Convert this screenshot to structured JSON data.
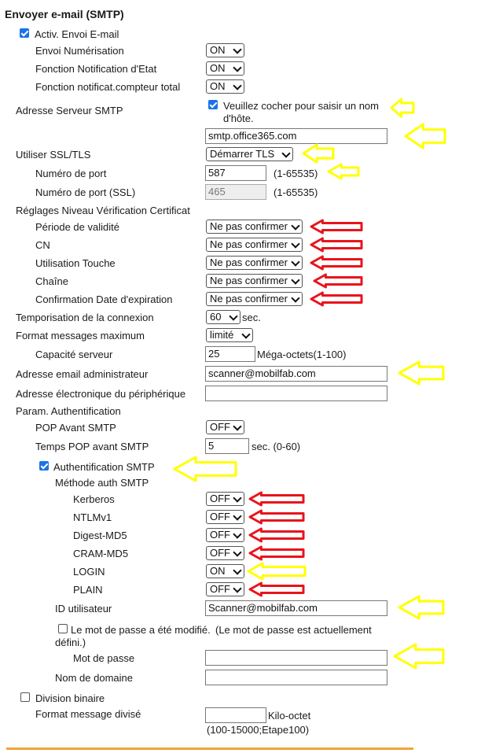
{
  "title": "Envoyer e-mail (SMTP)",
  "activ": {
    "label": "Activ. Envoi E-mail",
    "checked": true
  },
  "rows": {
    "envoi_num": {
      "label": "Envoi Numérisation",
      "value": "ON"
    },
    "notif_etat": {
      "label": "Fonction Notification d'Etat",
      "value": "ON"
    },
    "notif_compteur": {
      "label": "Fonction notificat.compteur total",
      "value": "ON"
    }
  },
  "smtp_server": {
    "label": "Adresse Serveur SMTP",
    "checkbox_label": "Veuillez cocher pour saisir un nom d'hôte.",
    "value": "smtp.office365.com"
  },
  "ssl": {
    "label": "Utiliser SSL/TLS",
    "value": "Démarrer TLS"
  },
  "port": {
    "label": "Numéro de port",
    "value": "587",
    "range": "(1-65535)"
  },
  "port_ssl": {
    "label": "Numéro de port (SSL)",
    "value": "465",
    "range": "(1-65535)"
  },
  "cert": {
    "label": "Réglages Niveau Vérification Certificat",
    "items": [
      {
        "label": "Période de validité",
        "value": "Ne pas confirmer"
      },
      {
        "label": "CN",
        "value": "Ne pas confirmer"
      },
      {
        "label": "Utilisation Touche",
        "value": "Ne pas confirmer"
      },
      {
        "label": "Chaîne",
        "value": "Ne pas confirmer"
      },
      {
        "label": "Confirmation Date d'expiration",
        "value": "Ne pas confirmer"
      }
    ]
  },
  "timeout": {
    "label": "Temporisation de la connexion",
    "value": "60",
    "unit": "sec."
  },
  "msgmax": {
    "label": "Format messages maximum",
    "value": "limité"
  },
  "capacity": {
    "label": "Capacité serveur",
    "value": "25",
    "unit": "Méga-octets(1-100)"
  },
  "admin_email": {
    "label": "Adresse email administrateur",
    "value": "scanner@mobilfab.com"
  },
  "device_email": {
    "label": "Adresse électronique du périphérique",
    "value": ""
  },
  "auth": {
    "label": "Param. Authentification"
  },
  "pop": {
    "label": "POP Avant SMTP",
    "value": "OFF"
  },
  "pop_time": {
    "label": "Temps POP avant SMTP",
    "value": "5",
    "unit": "sec. (0-60)"
  },
  "smtp_auth": {
    "label": "Authentification SMTP",
    "checked": true
  },
  "method": {
    "label": "Méthode auth SMTP"
  },
  "methods": [
    {
      "label": "Kerberos",
      "value": "OFF"
    },
    {
      "label": "NTLMv1",
      "value": "OFF"
    },
    {
      "label": "Digest-MD5",
      "value": "OFF"
    },
    {
      "label": "CRAM-MD5",
      "value": "OFF"
    },
    {
      "label": "LOGIN",
      "value": "ON"
    },
    {
      "label": "PLAIN",
      "value": "OFF"
    }
  ],
  "user_id": {
    "label": "ID utilisateur",
    "value": "Scanner@mobilfab.com"
  },
  "pwd_changed": {
    "label": "Le mot de passe a été modifié.",
    "note": "(Le mot de passe est actuellement",
    "note2": "défini.)",
    "checked": false
  },
  "password": {
    "label": "Mot de passe",
    "value": ""
  },
  "domain": {
    "label": "Nom de domaine",
    "value": ""
  },
  "split": {
    "label": "Division binaire",
    "checked": false
  },
  "split_format": {
    "label": "Format message divisé",
    "value": "",
    "unit": "Kilo-octet",
    "range": "(100-15000;Etape100)"
  },
  "colors": {
    "yellow_arrow": "#ffff00",
    "red_arrow": "#e8141b",
    "accent": "#f2a33a",
    "checkbox": "#1a73e8"
  }
}
